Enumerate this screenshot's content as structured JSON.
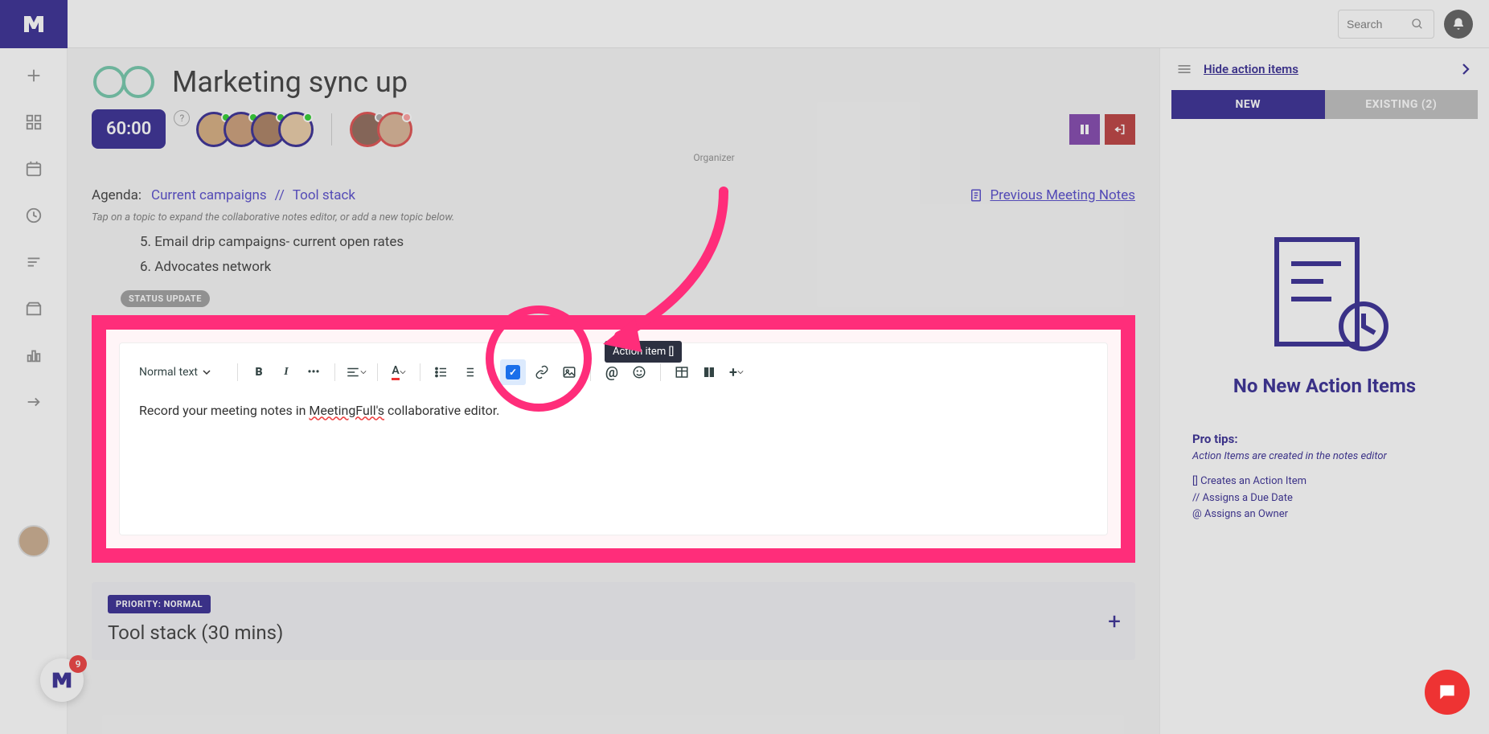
{
  "search": {
    "placeholder": "Search"
  },
  "meeting": {
    "title": "Marketing sync up",
    "timer": "60:00",
    "organizer_label": "Organizer"
  },
  "agenda": {
    "label": "Agenda:",
    "items": [
      "Current campaigns",
      "Tool stack"
    ],
    "prev_notes": "Previous Meeting Notes",
    "hint": "Tap on a topic to expand the collaborative notes editor, or add a new topic below."
  },
  "notes": {
    "items": [
      {
        "num": "5.",
        "text": "Email drip campaigns- current open rates"
      },
      {
        "num": "6.",
        "text": "Advocates network"
      }
    ],
    "status_pill": "STATUS UPDATE"
  },
  "editor": {
    "text_style": "Normal text",
    "tooltip": "Action item []",
    "content_prefix": "Record your meeting notes in ",
    "content_underlined": "MeetingFull's",
    "content_suffix": " collaborative editor."
  },
  "topic": {
    "priority": "PRIORITY: NORMAL",
    "title": "Tool stack (30 mins)"
  },
  "rightpanel": {
    "hide_link": "Hide action items",
    "tab_new": "NEW",
    "tab_existing": "EXISTING (2)",
    "empty_title": "No New Action Items",
    "tips_title": "Pro tips:",
    "tips_sub": "Action Items are created in the notes editor",
    "tip1": "[] Creates an Action Item",
    "tip2": "// Assigns a Due Date",
    "tip3": "@ Assigns an Owner"
  },
  "badge_count": "9"
}
